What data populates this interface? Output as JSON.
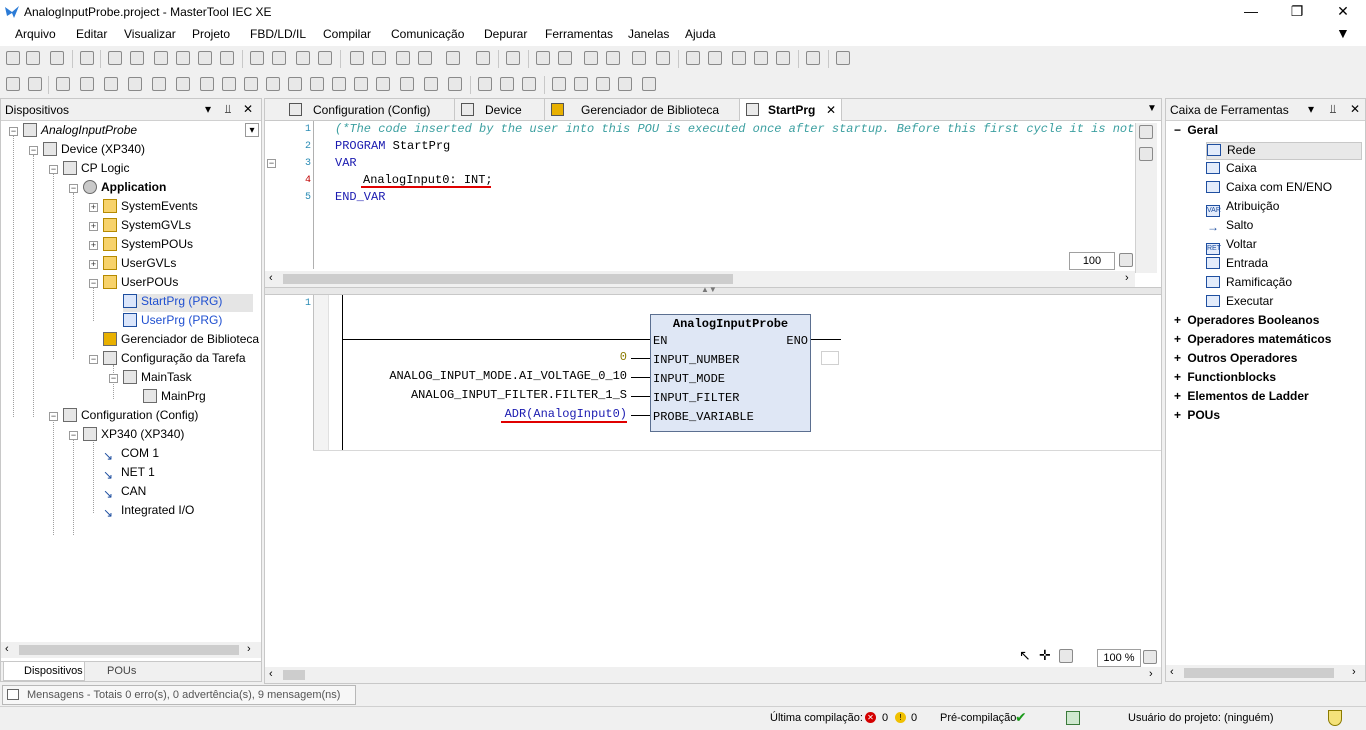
{
  "window": {
    "title": "AnalogInputProbe.project - MasterTool IEC XE",
    "minimize": "—",
    "maximize": "❐",
    "close": "✕"
  },
  "menu": [
    "Arquivo",
    "Editar",
    "Visualizar",
    "Projeto",
    "FBD/LD/IL",
    "Compilar",
    "Comunicação",
    "Depurar",
    "Ferramentas",
    "Janelas",
    "Ajuda"
  ],
  "left_panel": {
    "title": "Dispositivos",
    "tree": [
      {
        "label": "AnalogInputProbe",
        "style": "italic"
      },
      {
        "label": "Device (XP340)"
      },
      {
        "label": "CP Logic"
      },
      {
        "label": "Application",
        "style": "bold"
      },
      {
        "label": "SystemEvents"
      },
      {
        "label": "SystemGVLs"
      },
      {
        "label": "SystemPOUs"
      },
      {
        "label": "UserGVLs"
      },
      {
        "label": "UserPOUs"
      },
      {
        "label": "StartPrg (PRG)",
        "style": "link"
      },
      {
        "label": "UserPrg (PRG)",
        "style": "link"
      },
      {
        "label": "Gerenciador de Biblioteca"
      },
      {
        "label": "Configuração da Tarefa"
      },
      {
        "label": "MainTask"
      },
      {
        "label": "MainPrg"
      },
      {
        "label": "Configuration (Config)"
      },
      {
        "label": "XP340 (XP340)"
      },
      {
        "label": "COM 1"
      },
      {
        "label": "NET 1"
      },
      {
        "label": "CAN"
      },
      {
        "label": "Integrated I/O"
      }
    ],
    "bottom_tabs": [
      "Dispositivos",
      "POUs"
    ]
  },
  "editor": {
    "tabs": [
      {
        "label": "Configuration (Config)"
      },
      {
        "label": "Device"
      },
      {
        "label": "Gerenciador de Biblioteca"
      },
      {
        "label": "StartPrg",
        "active": true
      }
    ],
    "declaration": {
      "line_numbers": [
        "1",
        "2",
        "3",
        "4",
        "5"
      ],
      "comment": "(*The code inserted by the user into this POU is executed once after startup. Before this first cycle it is not ex",
      "program_kw": "PROGRAM",
      "program_name": "StartPrg",
      "var_kw": "VAR",
      "var_decl": "AnalogInput0: INT;",
      "end_var": "END_VAR",
      "zoom": "100"
    },
    "fbd": {
      "network_number": "1",
      "block_name": "AnalogInputProbe",
      "en": "EN",
      "eno": "ENO",
      "inputs": [
        {
          "pin": "INPUT_NUMBER",
          "value": "0"
        },
        {
          "pin": "INPUT_MODE",
          "value": "ANALOG_INPUT_MODE.AI_VOLTAGE_0_10"
        },
        {
          "pin": "INPUT_FILTER",
          "value": "ANALOG_INPUT_FILTER.FILTER_1_S"
        },
        {
          "pin": "PROBE_VARIABLE",
          "value": "ADR(AnalogInput0)"
        }
      ],
      "zoom": "100 %"
    }
  },
  "right_panel": {
    "title": "Caixa de Ferramentas",
    "geral_label": "Geral",
    "geral_items": [
      {
        "label": "Rede",
        "icon": "network-icon"
      },
      {
        "label": "Caixa",
        "icon": "box-icon"
      },
      {
        "label": "Caixa com EN/ENO",
        "icon": "box-en-eno-icon"
      },
      {
        "label": "Atribuição",
        "icon": "assignment-icon"
      },
      {
        "label": "Salto",
        "icon": "jump-icon"
      },
      {
        "label": "Voltar",
        "icon": "return-icon"
      },
      {
        "label": "Entrada",
        "icon": "input-icon"
      },
      {
        "label": "Ramificação",
        "icon": "branch-icon"
      },
      {
        "label": "Executar",
        "icon": "execute-icon"
      }
    ],
    "groups": [
      "Operadores Booleanos",
      "Operadores matemáticos",
      "Outros Operadores",
      "Functionblocks",
      "Elementos de Ladder",
      "POUs"
    ]
  },
  "messages": "Mensagens - Totais 0 erro(s), 0 advertência(s), 9 mensagem(ns)",
  "status": {
    "last_compile_label": "Última compilação:",
    "errors": "0",
    "warnings": "0",
    "precompile_label": "Pré-compilação",
    "user_label": "Usuário do projeto: (ninguém)"
  },
  "colors": {
    "keyword": "#1a1ab0",
    "comment": "#3b9fa0",
    "highlight_red": "#e00000",
    "block_fill": "#dfe7f5"
  }
}
